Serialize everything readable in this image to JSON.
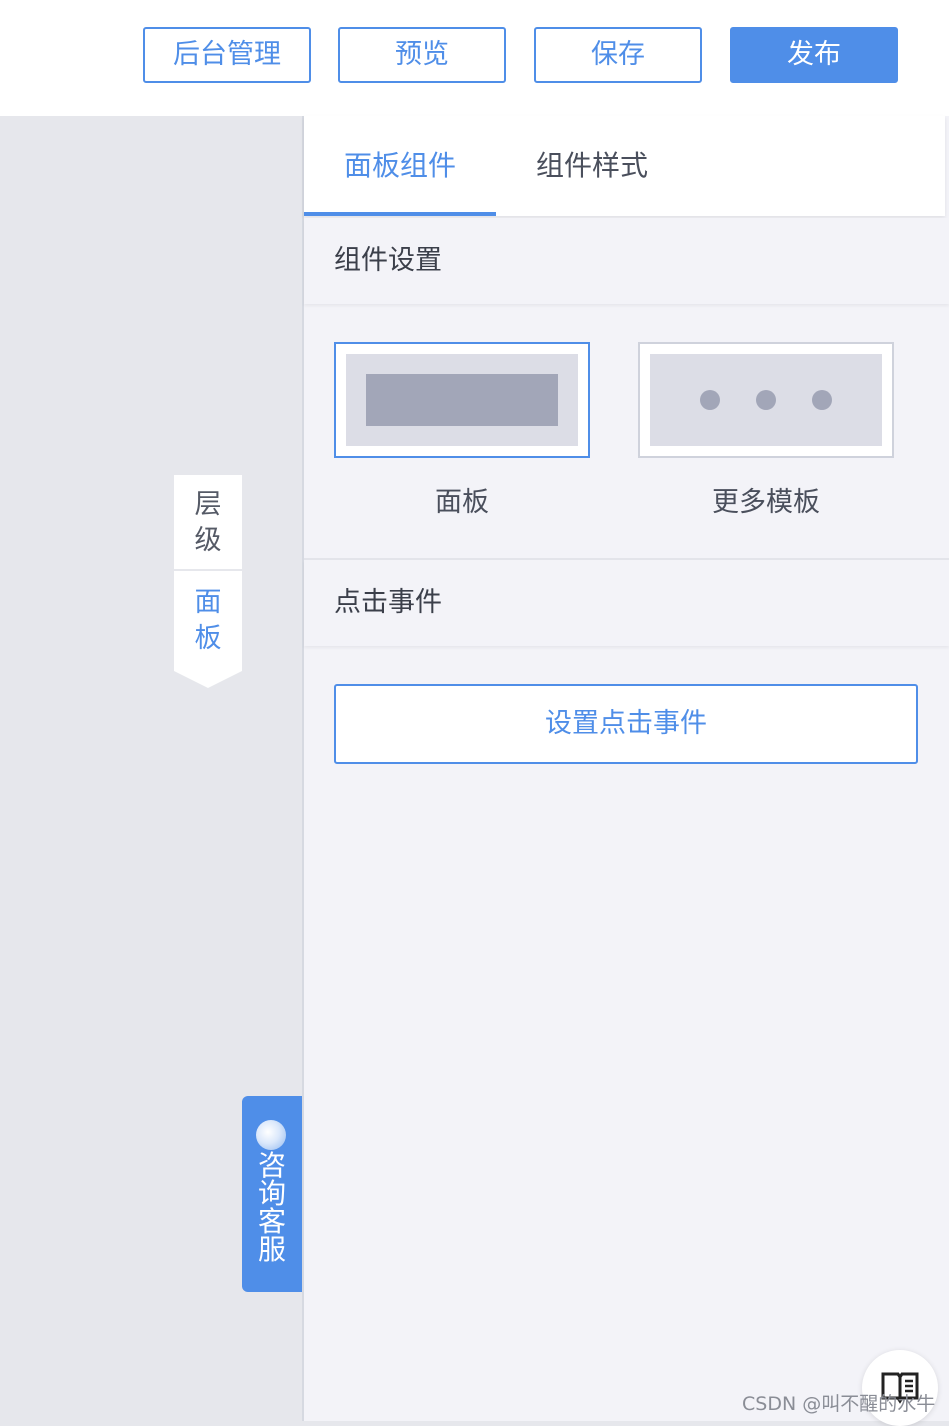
{
  "toolbar": {
    "backend_label": "后台管理",
    "preview_label": "预览",
    "save_label": "保存",
    "publish_label": "发布"
  },
  "side_tabs": {
    "levels": [
      "层",
      "级"
    ],
    "panel": [
      "面",
      "板"
    ]
  },
  "consult": {
    "label": [
      "咨",
      "询",
      "客",
      "服"
    ]
  },
  "panel": {
    "tabs": [
      {
        "label": "面板组件",
        "active": true
      },
      {
        "label": "组件样式",
        "active": false
      }
    ],
    "component_settings": {
      "title": "组件设置",
      "templates": [
        {
          "label": "面板",
          "selected": true
        },
        {
          "label": "更多模板",
          "selected": false
        }
      ]
    },
    "click_event": {
      "title": "点击事件",
      "button_label": "设置点击事件"
    }
  },
  "watermark": "CSDN @叫不醒的水牛",
  "colors": {
    "accent": "#4f8ee8",
    "canvas": "#e6e7ec",
    "panel_bg": "#f3f3f8"
  }
}
